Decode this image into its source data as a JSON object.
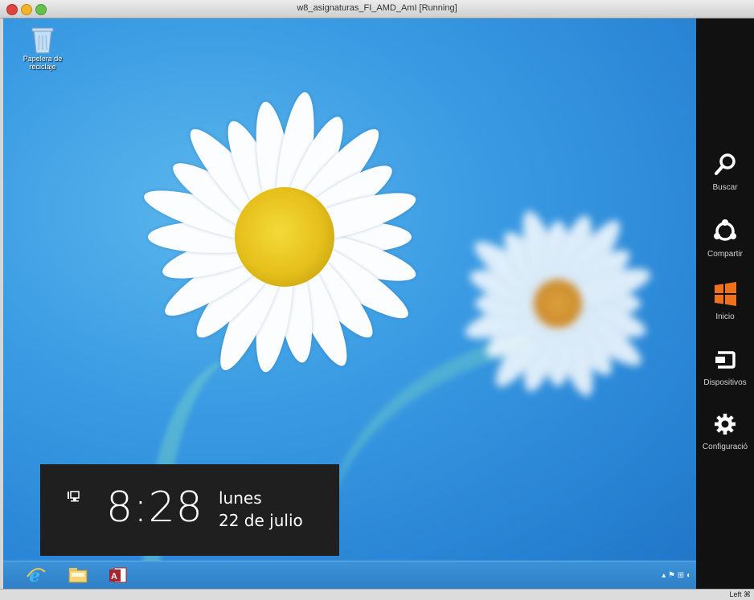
{
  "window": {
    "title": "w8_asignaturas_FI_AMD_AmI [Running]"
  },
  "desktop": {
    "icons": [
      {
        "label_line1": "Papelera de",
        "label_line2": "reciclaje",
        "icon": "recycle-bin-icon"
      }
    ]
  },
  "clock": {
    "time": "8:28",
    "day": "lunes",
    "date": "22 de julio",
    "icon": "network-icon"
  },
  "charms": [
    {
      "label": "Buscar",
      "icon": "search-icon"
    },
    {
      "label": "Compartir",
      "icon": "share-icon"
    },
    {
      "label": "Inicio",
      "icon": "windows-logo-icon",
      "color": "#f0711c"
    },
    {
      "label": "Dispositivos",
      "icon": "devices-icon"
    },
    {
      "label": "Configuració",
      "icon": "gear-icon"
    }
  ],
  "taskbar": {
    "apps": [
      {
        "name": "Internet Explorer",
        "icon": "ie-icon"
      },
      {
        "name": "Explorador de archivos",
        "icon": "folder-icon"
      },
      {
        "name": "Access",
        "icon": "access-icon"
      }
    ],
    "tray_text": "▴ ⚑ ⊞ ◐"
  },
  "host_status": {
    "host_key": "Left ⌘"
  }
}
